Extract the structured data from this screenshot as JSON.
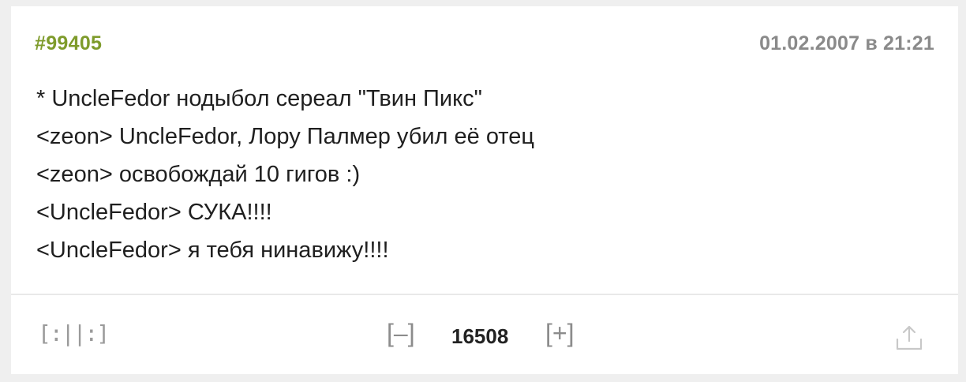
{
  "quote": {
    "id": "#99405",
    "date": "01.02.2007 в 21:21",
    "lines": [
      "* UncleFedor нодыбол сереал \"Твин Пикс\"",
      "<zeon> UncleFedor, Лору Палмер убил её отец",
      "<zeon> освобождай 10 гигов :)",
      "<UncleFedor> СУКА!!!!",
      "<UncleFedor> я тебя нинавижу!!!!"
    ]
  },
  "footer": {
    "comics_label": "[:||:]",
    "vote_down_label": "[–]",
    "rating": "16508",
    "vote_up_label": "[+]",
    "share_icon": "share-icon"
  },
  "colors": {
    "accent": "#7e9b2b",
    "date": "#8a8a8a",
    "text": "#1f1f1f",
    "muted": "#9a9a9a",
    "background": "#efefef"
  }
}
